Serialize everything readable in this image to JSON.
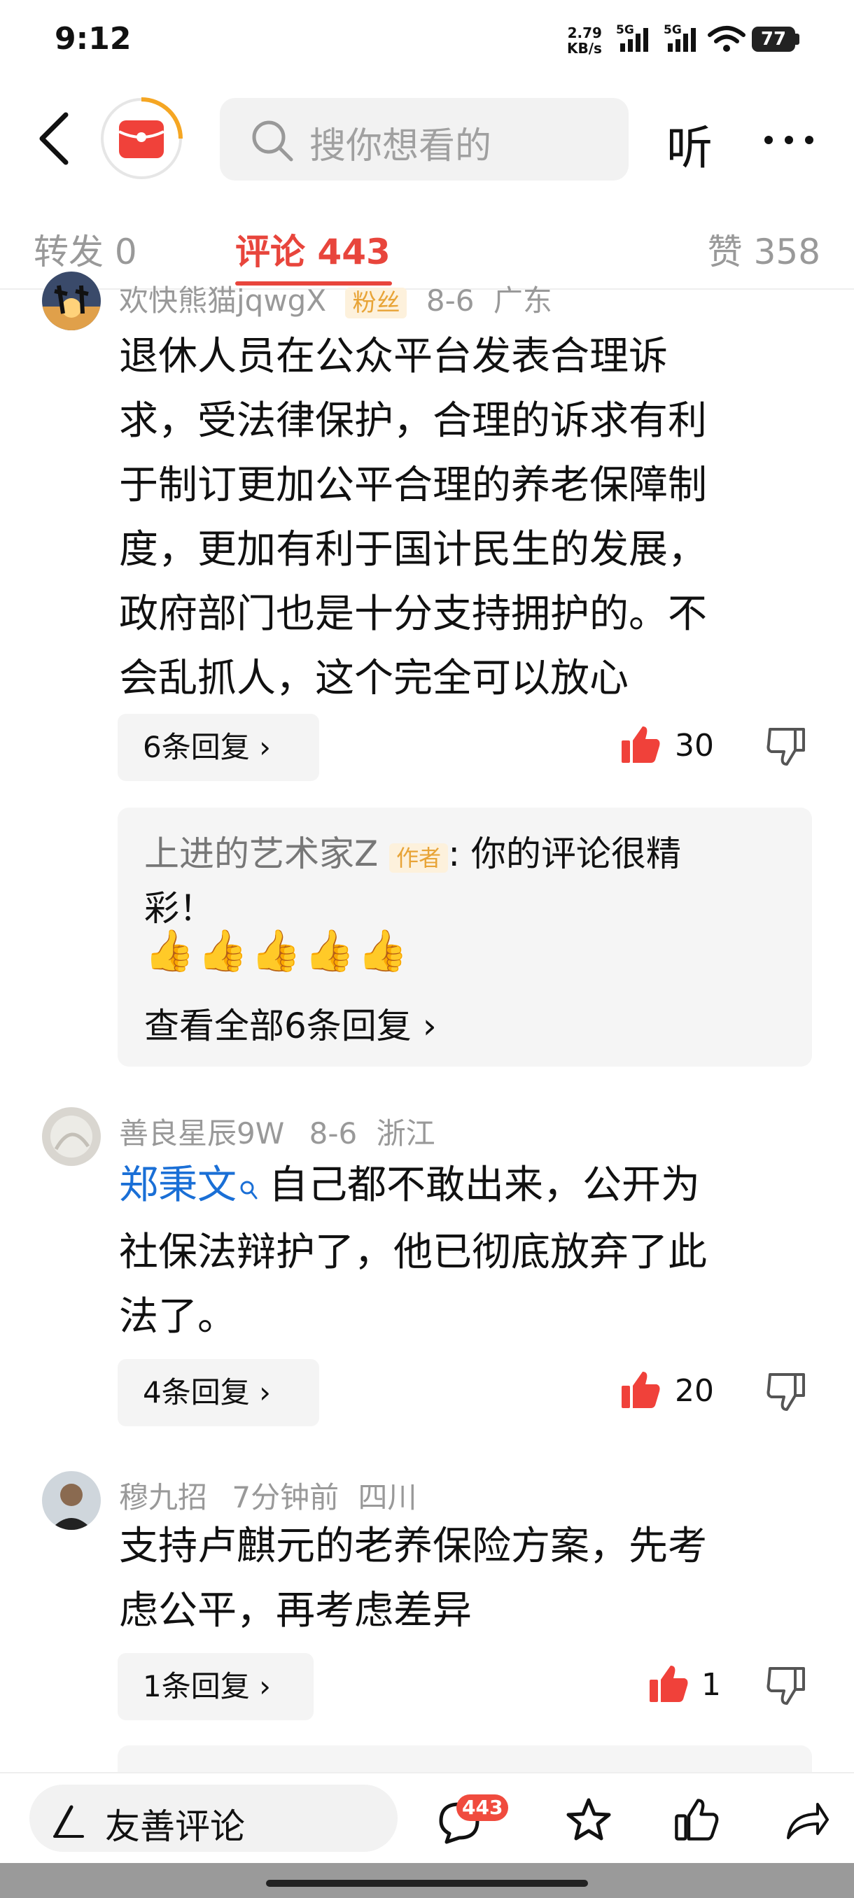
{
  "status": {
    "time": "9:12",
    "net_speed_value": "2.79",
    "net_speed_unit": "KB/s",
    "net_type1": "5G",
    "net_type2": "5G",
    "battery": "77"
  },
  "header": {
    "search_placeholder": "搜你想看的",
    "listen_label": "听",
    "more_icon": "more-icon"
  },
  "tabs": {
    "repost": "转发 0",
    "comments": "评论 443",
    "likes": "赞 358"
  },
  "comments": [
    {
      "user": "欢快熊猫jqwgX",
      "badge": "粉丝",
      "date": "8-6",
      "location": "广东",
      "lines": [
        "退休人员在公众平台发表合理诉",
        "求，受法律保护，合理的诉求有利",
        "于制订更加公平合理的养老保障制",
        "度，更加有利于国计民生的发展，",
        "政府部门也是十分支持拥护的。不",
        "会乱抓人，这个完全可以放心"
      ],
      "replies": "6条回复",
      "likes": "30",
      "author_reply": {
        "name": "上进的艺术家Z",
        "tag": "作者",
        "line1": ": 你的评论很精",
        "line2": "彩！",
        "emoji": "👍👍👍👍👍",
        "view_all": "查看全部6条回复"
      }
    },
    {
      "user": "善良星辰9W",
      "date": "8-6",
      "location": "浙江",
      "mention": "郑秉文",
      "line1": "自己都不敢出来，公开为",
      "lines": [
        "社保法辩护了，他已彻底放弃了此",
        "法了。"
      ],
      "replies": "4条回复",
      "likes": "20"
    },
    {
      "user": "穆九招",
      "date": "7分钟前",
      "location": "四川",
      "lines": [
        "支持卢麒元的老养保险方案，先考",
        "虑公平，再考虑差异"
      ],
      "replies": "1条回复",
      "likes": "1"
    }
  ],
  "bottom": {
    "input_label": "友善评论",
    "comment_count": "443"
  },
  "colors": {
    "accent": "#e8453c",
    "meta": "#999999",
    "link": "#1a6fd6",
    "author_tag": "#f0a020"
  }
}
